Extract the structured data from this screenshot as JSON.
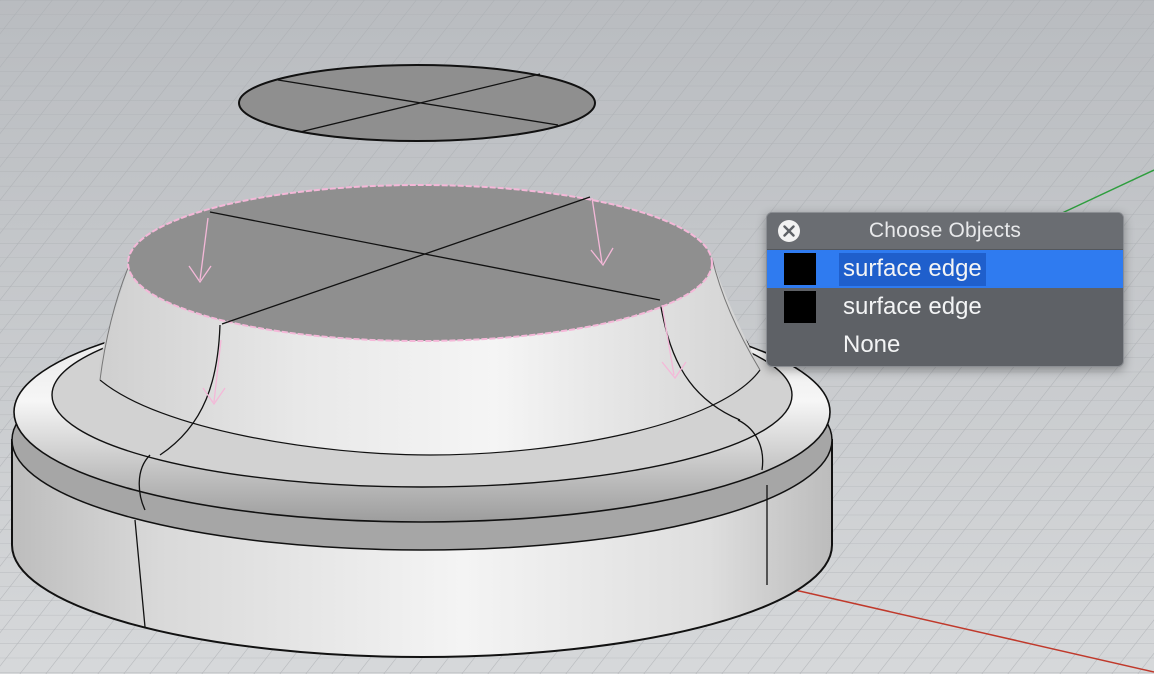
{
  "chooser": {
    "title": "Choose Objects",
    "items": [
      {
        "label": "surface edge",
        "swatch": "#000000",
        "selected": true
      },
      {
        "label": "surface edge",
        "swatch": "#000000",
        "selected": false
      },
      {
        "label": "None",
        "swatch": null,
        "selected": false
      }
    ]
  },
  "icons": {
    "close": "close-circle-icon"
  },
  "colors": {
    "selection_highlight": "#2f7bf0",
    "grid_x_axis": "#c0392b",
    "grid_y_axis": "#2e9e3e",
    "edge_highlight": "#f4b8d8"
  }
}
